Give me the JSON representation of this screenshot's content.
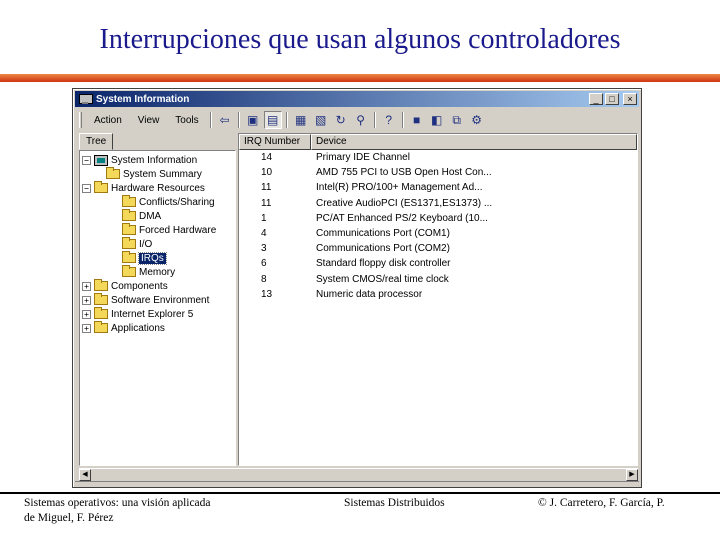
{
  "slide": {
    "title": "Interrupciones que usan algunos controladores"
  },
  "window": {
    "title": "System Information",
    "controls": {
      "minimize": "_",
      "maximize": "□",
      "close": "×"
    }
  },
  "menu": [
    "Action",
    "View",
    "Tools"
  ],
  "toolbar": {
    "icons": [
      "back-arrow-icon",
      "up-folder-icon",
      "properties-icon",
      "print-icon",
      "print-preview-icon",
      "refresh-icon",
      "find-icon",
      "help-icon",
      "save-icon",
      "open-icon",
      "export-icon",
      "tools-icon"
    ]
  },
  "tree": {
    "tab_label": "Tree",
    "root": "System Information",
    "summary": "System Summary",
    "hardware": "Hardware Resources",
    "hardware_children": [
      "Conflicts/Sharing",
      "DMA",
      "Forced Hardware",
      "I/O",
      "IRQs",
      "Memory"
    ],
    "components": "Components",
    "software": "Software Environment",
    "ie": "Internet Explorer 5",
    "applications": "Applications"
  },
  "list": {
    "columns": {
      "irq": "IRQ Number",
      "device": "Device"
    },
    "rows": [
      {
        "irq": "14",
        "device": "Primary IDE Channel"
      },
      {
        "irq": "10",
        "device": "AMD 755 PCI to USB Open Host Con..."
      },
      {
        "irq": "11",
        "device": "Intel(R) PRO/100+ Management Ad..."
      },
      {
        "irq": "11",
        "device": "Creative AudioPCI (ES1371,ES1373) ..."
      },
      {
        "irq": "1",
        "device": "PC/AT Enhanced PS/2 Keyboard (10..."
      },
      {
        "irq": "4",
        "device": "Communications Port (COM1)"
      },
      {
        "irq": "3",
        "device": "Communications Port (COM2)"
      },
      {
        "irq": "6",
        "device": "Standard floppy disk controller"
      },
      {
        "irq": "8",
        "device": "System CMOS/real time clock"
      },
      {
        "irq": "13",
        "device": "Numeric data processor"
      }
    ]
  },
  "footer": {
    "left_line1": "Sistemas operativos: una visión aplicada",
    "left_line2": "de Miguel, F. Pérez",
    "center": "Sistemas Distribuidos",
    "right": "© J. Carretero, F. García, P."
  }
}
